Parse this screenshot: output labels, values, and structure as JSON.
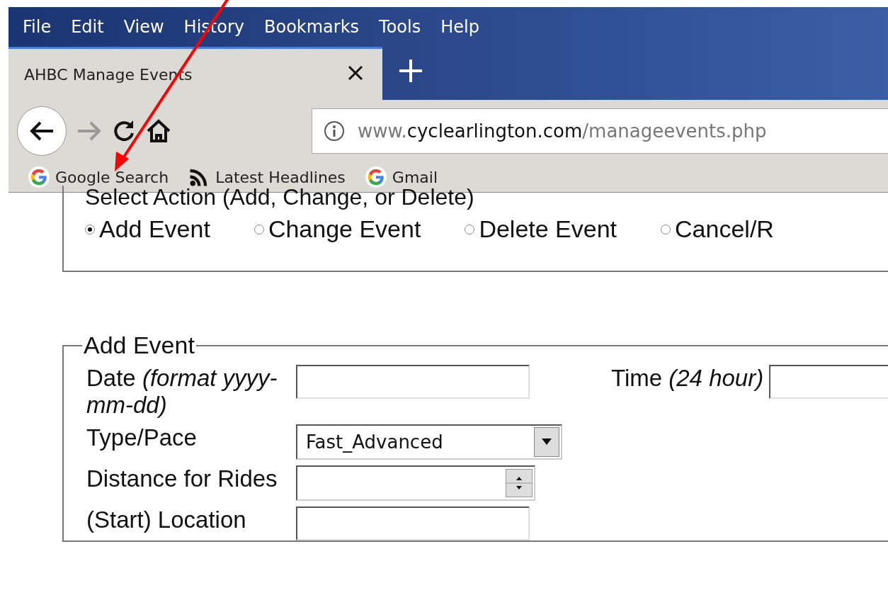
{
  "menu": [
    "File",
    "Edit",
    "View",
    "History",
    "Bookmarks",
    "Tools",
    "Help"
  ],
  "tabs": [
    {
      "label": "AHBC Manage Events",
      "selected": true
    }
  ],
  "nav": {
    "back_disabled": false,
    "forward_disabled": true
  },
  "address": {
    "prefix": "www.",
    "domain": "cyclearlington.com",
    "path": "/manageevents.php"
  },
  "bookmarks": [
    {
      "label": "Google Search",
      "kind": "google"
    },
    {
      "label": "Latest Headlines",
      "kind": "feed"
    },
    {
      "label": "Gmail",
      "kind": "google"
    }
  ],
  "action_group": {
    "legend": "Select Action (Add, Change, or Delete)",
    "options": [
      {
        "label": "Add Event",
        "selected": true
      },
      {
        "label": "Change Event",
        "selected": false
      },
      {
        "label": "Delete Event",
        "selected": false
      },
      {
        "label": "Cancel/R",
        "selected": false
      }
    ]
  },
  "add_event": {
    "legend": "Add Event",
    "fields": [
      {
        "label": "Date",
        "hint": "(format yyyy-mm-dd)",
        "kind": "text"
      },
      {
        "label": "Time",
        "hint": "(24 hour)",
        "kind": "text"
      },
      {
        "label": "Type/Pace",
        "kind": "select",
        "value": "Fast_Advanced"
      },
      {
        "label": "Distance for Rides",
        "kind": "number"
      },
      {
        "label": "(Start) Location",
        "kind": "text"
      }
    ]
  }
}
